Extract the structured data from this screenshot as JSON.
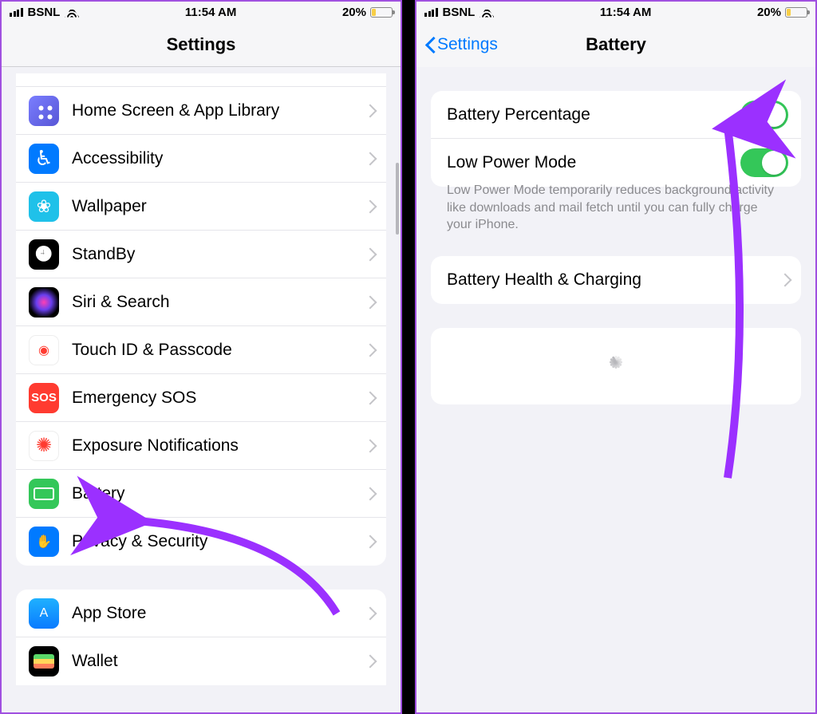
{
  "status": {
    "carrier": "BSNL",
    "time": "11:54 AM",
    "battery_pct": "20%"
  },
  "left": {
    "title": "Settings",
    "group1": [
      {
        "label": "Home Screen & App Library",
        "icon": "ic-grid"
      },
      {
        "label": "Accessibility",
        "icon": "ic-access",
        "glyph": "♿︎"
      },
      {
        "label": "Wallpaper",
        "icon": "ic-wall"
      },
      {
        "label": "StandBy",
        "icon": "ic-standby"
      },
      {
        "label": "Siri & Search",
        "icon": "ic-siri"
      },
      {
        "label": "Touch ID & Passcode",
        "icon": "ic-touch",
        "glyph": "◉"
      },
      {
        "label": "Emergency SOS",
        "icon": "ic-sos",
        "glyph": "SOS"
      },
      {
        "label": "Exposure Notifications",
        "icon": "ic-expo"
      },
      {
        "label": "Battery",
        "icon": "ic-batt"
      },
      {
        "label": "Privacy & Security",
        "icon": "ic-priv",
        "glyph": "✋"
      }
    ],
    "group2": [
      {
        "label": "App Store",
        "icon": "ic-appstore",
        "glyph": "A"
      },
      {
        "label": "Wallet",
        "icon": "ic-wallet"
      }
    ]
  },
  "right": {
    "back_label": "Settings",
    "title": "Battery",
    "rows": {
      "battery_percentage": "Battery Percentage",
      "low_power_mode": "Low Power Mode"
    },
    "footer": "Low Power Mode temporarily reduces background activity like downloads and mail fetch until you can fully charge your iPhone.",
    "health_row": "Battery Health & Charging"
  }
}
